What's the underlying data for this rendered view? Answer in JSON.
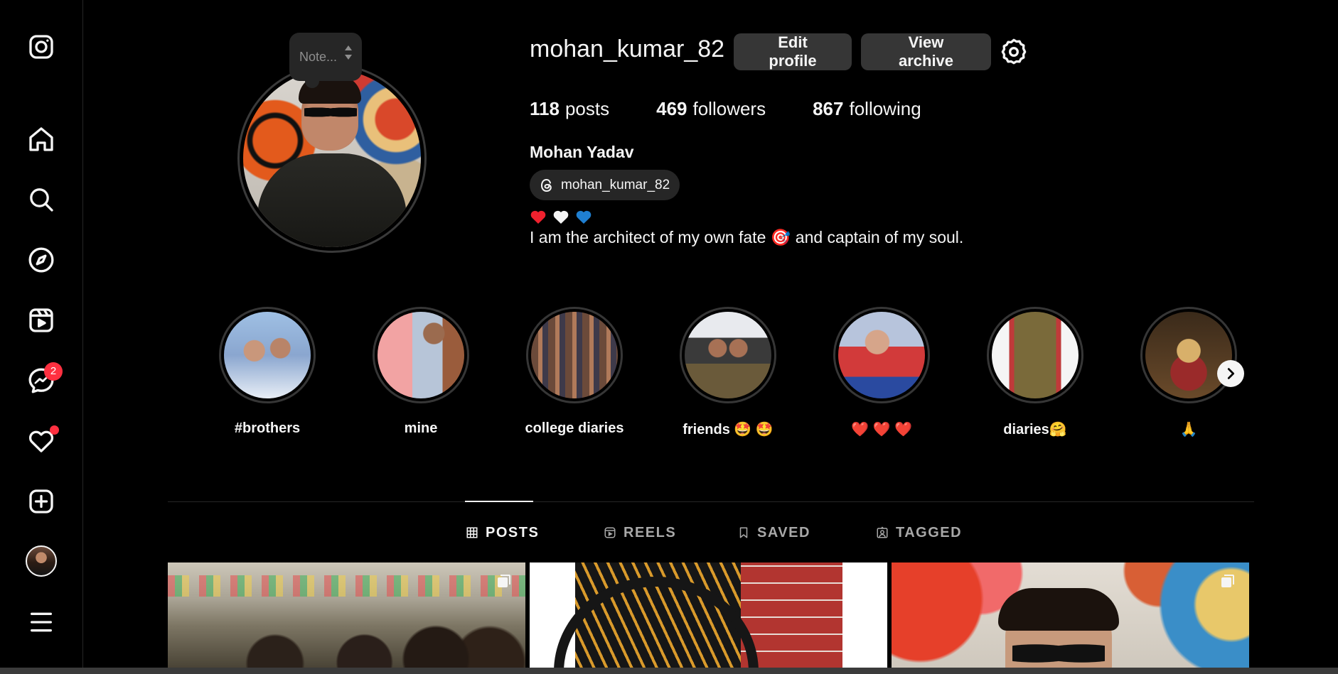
{
  "sidebar": {
    "messages_badge": "2",
    "items": [
      {
        "name": "instagram-logo-icon"
      },
      {
        "name": "home-icon"
      },
      {
        "name": "search-icon"
      },
      {
        "name": "explore-icon"
      },
      {
        "name": "reels-icon"
      },
      {
        "name": "messenger-icon"
      },
      {
        "name": "notifications-heart-icon"
      },
      {
        "name": "create-plus-icon"
      },
      {
        "name": "profile-avatar"
      },
      {
        "name": "menu-icon"
      }
    ]
  },
  "note": {
    "placeholder": "Note..."
  },
  "profile": {
    "username": "mohan_kumar_82",
    "edit_label": "Edit profile",
    "archive_label": "View archive",
    "stats": {
      "posts_count": "118",
      "posts_label": "posts",
      "followers_count": "469",
      "followers_label": "followers",
      "following_count": "867",
      "following_label": "following"
    },
    "full_name": "Mohan Yadav",
    "threads_handle": "mohan_kumar_82",
    "bio_hearts": [
      "red",
      "white",
      "blue"
    ],
    "bio": "I am the architect of my own fate 🎯 and captain of my soul."
  },
  "highlights": [
    {
      "label": "#brothers"
    },
    {
      "label": "mine"
    },
    {
      "label": "college diaries"
    },
    {
      "label": "friends 🤩 🤩"
    },
    {
      "label": "❤️ ❤️ ❤️"
    },
    {
      "label": "diaries🤗"
    },
    {
      "label": "🙏"
    }
  ],
  "tabs": [
    {
      "label": "POSTS",
      "active": true
    },
    {
      "label": "REELS",
      "active": false
    },
    {
      "label": "SAVED",
      "active": false
    },
    {
      "label": "TAGGED",
      "active": false
    }
  ],
  "colors": {
    "background": "#000000",
    "button": "#363636",
    "badge": "#ff3040",
    "muted": "#a8a8a8"
  }
}
